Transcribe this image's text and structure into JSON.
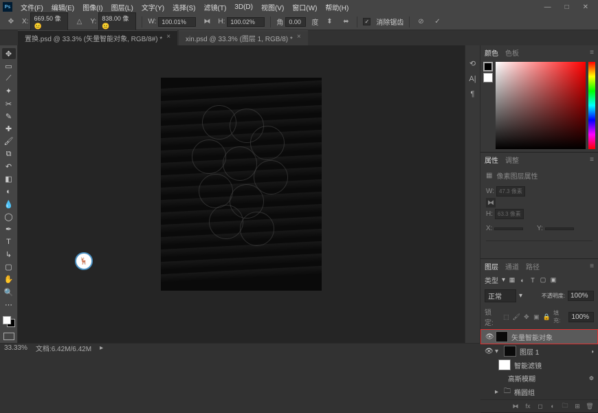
{
  "menu": {
    "items": [
      "文件(F)",
      "编辑(E)",
      "图像(I)",
      "图层(L)",
      "文字(Y)",
      "选择(S)",
      "滤镜(T)",
      "3D(D)",
      "视图(V)",
      "窗口(W)",
      "帮助(H)"
    ],
    "logo": "Ps"
  },
  "options": {
    "x_label": "X:",
    "x_value": "669.50 像😐",
    "y_label": "Y:",
    "y_value": "838.00 像😐",
    "w_label": "W:",
    "w_value": "100.01%",
    "h_label": "H:",
    "h_value": "100.02%",
    "angle_label": "角",
    "angle_value": "0.00",
    "skew_label": "度",
    "interp_label": "消除锯齿"
  },
  "tabs": [
    {
      "label": "置换.psd @ 33.3% (矢量智能对象, RGB/8#) *",
      "active": true
    },
    {
      "label": "xin.psd @ 33.3% (图层 1, RGB/8) *",
      "active": false
    }
  ],
  "panels": {
    "color": {
      "tab1": "颜色",
      "tab2": "色板"
    },
    "props": {
      "tab1": "属性",
      "tab2": "调整",
      "title": "像素图层属性",
      "w": "W:",
      "w_val": "47.3 像素",
      "h": "H:",
      "h_val": "63.3 像素",
      "x": "X:",
      "x_val": "",
      "y": "Y:",
      "y_val": ""
    },
    "layers": {
      "tab1": "图层",
      "tab2": "通道",
      "tab3": "路径",
      "kind": "类型",
      "blend": "正常",
      "opacity_label": "不透明度:",
      "opacity": "100%",
      "lock_label": "锁定:",
      "fill_label": "填充:",
      "fill": "100%",
      "items": [
        {
          "name": "矢量智能对象",
          "selected": true
        },
        {
          "name": "图层 1"
        },
        {
          "name": "智能滤镜"
        },
        {
          "name": "高斯模糊"
        },
        {
          "name": "椭圆组"
        }
      ]
    }
  },
  "status": {
    "zoom": "33.33%",
    "doc": "文档:6.42M/6.42M"
  },
  "window_controls": {
    "min": "—",
    "max": "□",
    "close": "✕"
  }
}
